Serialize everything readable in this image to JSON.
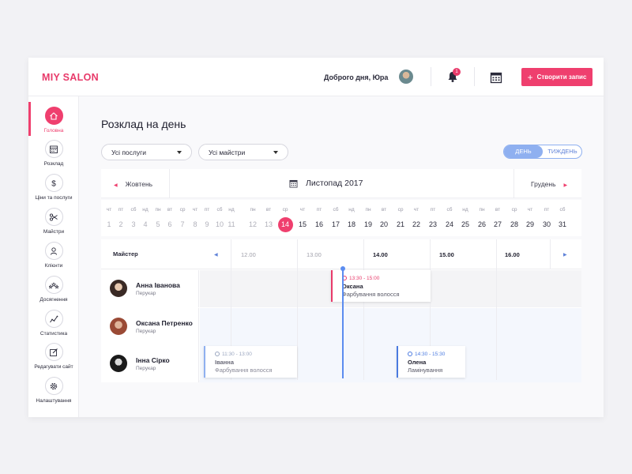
{
  "header": {
    "logo": "MIY SALON",
    "greeting": "Доброго дня, Юра",
    "notification_count": "1",
    "create_button": "Створити запис",
    "accent": "#ef3f6e"
  },
  "sidebar": {
    "items": [
      {
        "label": "Головна",
        "icon": "home-icon",
        "active": true
      },
      {
        "label": "Розклад",
        "icon": "calendar-icon"
      },
      {
        "label": "Ціни та послуги",
        "icon": "dollar-icon"
      },
      {
        "label": "Майстри",
        "icon": "scissors-icon"
      },
      {
        "label": "Клієнти",
        "icon": "clients-icon"
      },
      {
        "label": "Досягнення",
        "icon": "stars-icon"
      },
      {
        "label": "Статистика",
        "icon": "chart-icon"
      },
      {
        "label": "Редагувати сайт",
        "icon": "edit-icon"
      },
      {
        "label": "Налаштування",
        "icon": "gear-icon"
      }
    ]
  },
  "page": {
    "title": "Розклад на день",
    "filter_services": "Усі послуги",
    "filter_masters": "Усі майстри",
    "view_day": "ДЕНЬ",
    "view_week": "ТИЖДЕНЬ"
  },
  "month_nav": {
    "prev": "Жовтень",
    "current": "Листопад 2017",
    "next": "Грудень"
  },
  "days": [
    {
      "dn": "чт",
      "dd": "1",
      "cur": false
    },
    {
      "dn": "пт",
      "dd": "2",
      "cur": false
    },
    {
      "dn": "сб",
      "dd": "3",
      "cur": false
    },
    {
      "dn": "нд",
      "dd": "4",
      "cur": false
    },
    {
      "dn": "пн",
      "dd": "5",
      "cur": false
    },
    {
      "dn": "вт",
      "dd": "6",
      "cur": false
    },
    {
      "dn": "ср",
      "dd": "7",
      "cur": false
    },
    {
      "dn": "чт",
      "dd": "8",
      "cur": false
    },
    {
      "dn": "пт",
      "dd": "9",
      "cur": false
    },
    {
      "dn": "сб",
      "dd": "10",
      "cur": false
    },
    {
      "dn": "нд",
      "dd": "11",
      "cur": false
    },
    {
      "dn": "пн",
      "dd": "12",
      "cur": false
    },
    {
      "dn": "вт",
      "dd": "13",
      "cur": false
    },
    {
      "dn": "ср",
      "dd": "14",
      "cur": true,
      "today": true
    },
    {
      "dn": "чт",
      "dd": "15",
      "cur": true
    },
    {
      "dn": "пт",
      "dd": "16",
      "cur": true
    },
    {
      "dn": "сб",
      "dd": "17",
      "cur": true
    },
    {
      "dn": "нд",
      "dd": "18",
      "cur": true
    },
    {
      "dn": "пн",
      "dd": "19",
      "cur": true
    },
    {
      "dn": "вт",
      "dd": "20",
      "cur": true
    },
    {
      "dn": "ср",
      "dd": "21",
      "cur": true
    },
    {
      "dn": "чт",
      "dd": "22",
      "cur": true
    },
    {
      "dn": "пт",
      "dd": "23",
      "cur": true
    },
    {
      "dn": "сб",
      "dd": "24",
      "cur": true
    },
    {
      "dn": "нд",
      "dd": "25",
      "cur": true
    },
    {
      "dn": "пн",
      "dd": "26",
      "cur": true
    },
    {
      "dn": "вт",
      "dd": "27",
      "cur": true
    },
    {
      "dn": "ср",
      "dd": "28",
      "cur": true
    },
    {
      "dn": "чт",
      "dd": "29",
      "cur": true
    },
    {
      "dn": "пт",
      "dd": "30",
      "cur": true
    },
    {
      "dn": "сб",
      "dd": "31",
      "cur": true
    }
  ],
  "schedule": {
    "master_header": "Майстер",
    "times": [
      "12.00",
      "13.00",
      "14.00",
      "15.00",
      "16.00"
    ],
    "masters": [
      {
        "name": "Анна Іванова",
        "role": "Перукар"
      },
      {
        "name": "Оксана Петренко",
        "role": "Перукар"
      },
      {
        "name": "Інна Сірко",
        "role": "Перукар"
      }
    ],
    "appointments": [
      {
        "time": "13:30 - 15:00",
        "client": "Оксана",
        "service": "Фарбування волосся",
        "color": "#e83a6a"
      },
      {
        "time": "11:30 - 13:00",
        "client": "Іванна",
        "service": "Фарбування волосся",
        "color": "#8fb0f0"
      },
      {
        "time": "14:30 - 15:30",
        "client": "Олена",
        "service": "Ламінування",
        "color": "#4a7ae0"
      }
    ]
  }
}
